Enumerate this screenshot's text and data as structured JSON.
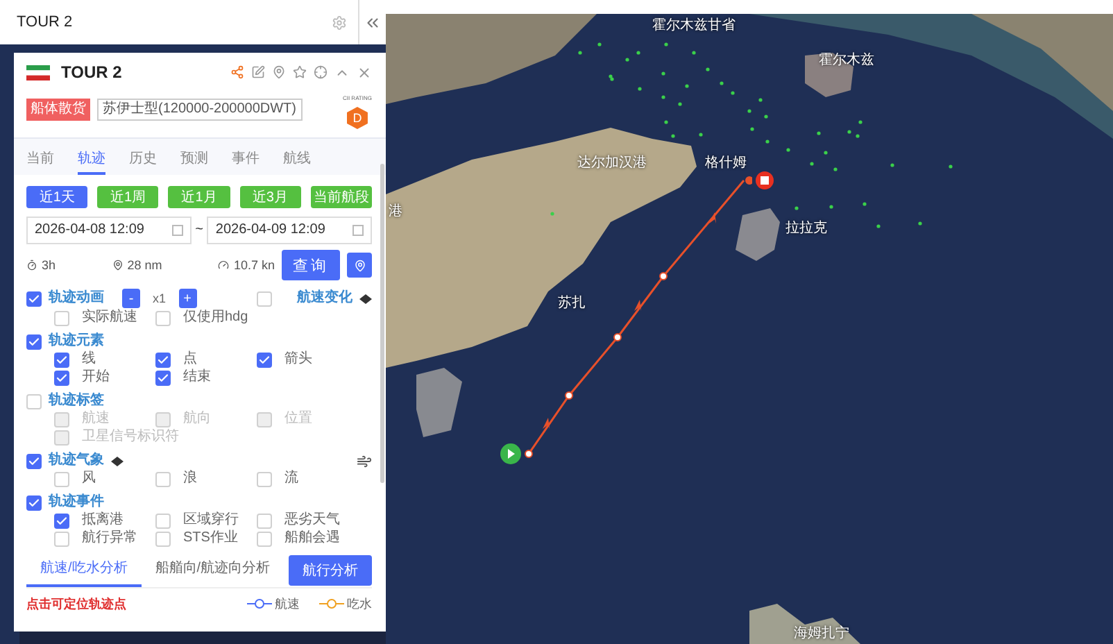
{
  "search": {
    "value": "TOUR 2"
  },
  "vessel": {
    "name": "TOUR 2",
    "status_tag": "船体散货",
    "type": "苏伊士型(120000-200000DWT)",
    "rating_caption": "CII RATING",
    "rating": "D"
  },
  "tabs": [
    {
      "label": "当前",
      "selected": false
    },
    {
      "label": "轨迹",
      "selected": true
    },
    {
      "label": "历史",
      "selected": false
    },
    {
      "label": "预测",
      "selected": false
    },
    {
      "label": "事件",
      "selected": false
    },
    {
      "label": "航线",
      "selected": false
    }
  ],
  "ranges": [
    {
      "label": "近1天",
      "selected": true
    },
    {
      "label": "近1周",
      "selected": false
    },
    {
      "label": "近1月",
      "selected": false
    },
    {
      "label": "近3月",
      "selected": false
    },
    {
      "label": "当前航段",
      "selected": false
    }
  ],
  "dates": {
    "start": "2026-04-08 12:09",
    "separator": "~",
    "end": "2026-04-09 12:09"
  },
  "stats": {
    "duration": "3h",
    "distance": "28 nm",
    "speed": "10.7 kn"
  },
  "query_button": "查询",
  "sections": [
    {
      "label": "轨迹动画",
      "checked": true,
      "kind": "animation",
      "speed": {
        "minus": "-",
        "value": "x1",
        "plus": "+"
      },
      "side_toggle": {
        "label": "航速变化",
        "checked": false
      },
      "options": [
        {
          "label": "实际航速",
          "checked": false,
          "disabled": false
        },
        {
          "label": "仅使用hdg",
          "checked": false,
          "disabled": false
        }
      ]
    },
    {
      "label": "轨迹元素",
      "checked": true,
      "kind": "plain",
      "options": [
        {
          "label": "线",
          "checked": true,
          "disabled": false
        },
        {
          "label": "点",
          "checked": true,
          "disabled": false
        },
        {
          "label": "箭头",
          "checked": true,
          "disabled": false
        },
        {
          "label": "开始",
          "checked": true,
          "disabled": false
        },
        {
          "label": "结束",
          "checked": true,
          "disabled": false
        }
      ]
    },
    {
      "label": "轨迹标签",
      "checked": false,
      "kind": "plain",
      "options": [
        {
          "label": "航速",
          "checked": false,
          "disabled": true
        },
        {
          "label": "航向",
          "checked": false,
          "disabled": true
        },
        {
          "label": "位置",
          "checked": false,
          "disabled": true
        },
        {
          "label": "卫星信号标识符",
          "checked": false,
          "disabled": true
        }
      ]
    },
    {
      "label": "轨迹气象",
      "checked": true,
      "kind": "weather",
      "options": [
        {
          "label": "风",
          "checked": false,
          "disabled": false
        },
        {
          "label": "浪",
          "checked": false,
          "disabled": false
        },
        {
          "label": "流",
          "checked": false,
          "disabled": false
        }
      ]
    },
    {
      "label": "轨迹事件",
      "checked": true,
      "kind": "plain",
      "options": [
        {
          "label": "抵离港",
          "checked": true,
          "disabled": false
        },
        {
          "label": "区域穿行",
          "checked": false,
          "disabled": false
        },
        {
          "label": "恶劣天气",
          "checked": false,
          "disabled": false
        },
        {
          "label": "航行异常",
          "checked": false,
          "disabled": false
        },
        {
          "label": "STS作业",
          "checked": false,
          "disabled": false
        },
        {
          "label": "船舶会遇",
          "checked": false,
          "disabled": false
        }
      ]
    }
  ],
  "analysis_tabs": [
    {
      "label": "航速/吃水分析",
      "selected": true
    },
    {
      "label": "船艏向/航迹向分析",
      "selected": false
    }
  ],
  "analysis_button": "航行分析",
  "hint": "点击可定位轨迹点",
  "legend": [
    {
      "label": "航速",
      "color": "#4a6cf7"
    },
    {
      "label": "吃水",
      "color": "#f0a020"
    }
  ],
  "map_labels": [
    {
      "text": "霍尔木兹甘省"
    },
    {
      "text": "霍尔木兹"
    },
    {
      "text": "达尔加汉港"
    },
    {
      "text": "格什姆"
    },
    {
      "text": "拉拉克"
    },
    {
      "text": "苏扎"
    },
    {
      "text": "海姆扎宁"
    },
    {
      "text": "港"
    }
  ]
}
